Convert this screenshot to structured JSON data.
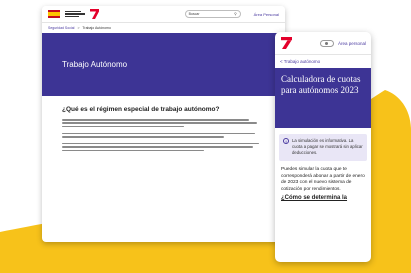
{
  "desktop": {
    "search_label": "Buscar",
    "area_personal": "Área Personal",
    "breadcrumb": [
      "Seguridad Social",
      "Trabajo Autónomo"
    ],
    "hero_title": "Trabajo Autónomo",
    "section_title": "¿Qué es el régimen especial de trabajo autónomo?"
  },
  "mobile": {
    "area_personal": "Área personal",
    "back_link": "< Trabajo autónomo",
    "hero_title": "Calculadora de cuotas para autónomos 2023",
    "notice": "La simulación es informativa. La cuota a pagar se mostrará sin aplicar deducciones.",
    "body_text": "Puedes simular la cuota que te corresponderá abonar a partir de enero de 2023 con el nuevo sistema de cotización por rendimientos.",
    "subheading": "¿Cómo se determina la"
  },
  "colors": {
    "accent": "#3d3495",
    "yellow": "#f7c21a"
  }
}
